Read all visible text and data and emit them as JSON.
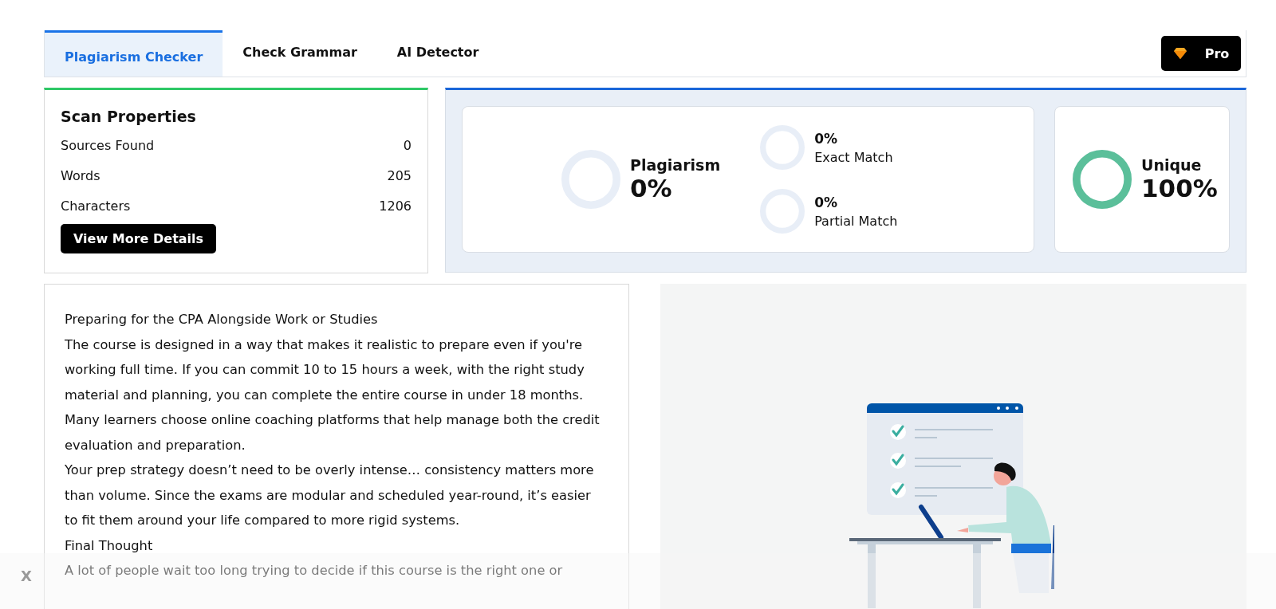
{
  "tabs": [
    {
      "label": "Plagiarism Checker",
      "selected": true
    },
    {
      "label": "Check Grammar",
      "selected": false
    },
    {
      "label": "AI Detector",
      "selected": false
    }
  ],
  "pro_button": {
    "label": "Pro"
  },
  "scan_properties": {
    "title": "Scan Properties",
    "rows": [
      {
        "label": "Sources Found",
        "value": "0"
      },
      {
        "label": "Words",
        "value": "205"
      },
      {
        "label": "Characters",
        "value": "1206"
      }
    ],
    "button": "View More Details"
  },
  "results": {
    "plagiarism": {
      "label": "Plagiarism",
      "value": "0%",
      "level": 0
    },
    "matches": [
      {
        "value": "0%",
        "label": "Exact Match",
        "level": 0
      },
      {
        "value": "0%",
        "label": "Partial Match",
        "level": 0
      }
    ],
    "unique": {
      "label": "Unique",
      "value": "100%",
      "level": 1
    }
  },
  "document": {
    "paragraphs": [
      "Preparing for the CPA Alongside Work or Studies",
      "The course is designed in a way that makes it realistic to prepare even if you're working full time. If you can commit 10 to 15 hours a week, with the right study material and planning, you can complete the entire course in under 18 months. Many learners choose online coaching platforms that help manage both the credit evaluation and preparation.",
      "Your prep strategy doesn’t need to be overly intense… consistency matters more than volume. Since the exams are modular and scheduled year-round, it’s easier to fit them around your life compared to more rigid systems.",
      "Final Thought",
      "A lot of people wait too long trying to decide if this course is the right one or"
    ]
  },
  "overlay": {
    "close": "X"
  }
}
